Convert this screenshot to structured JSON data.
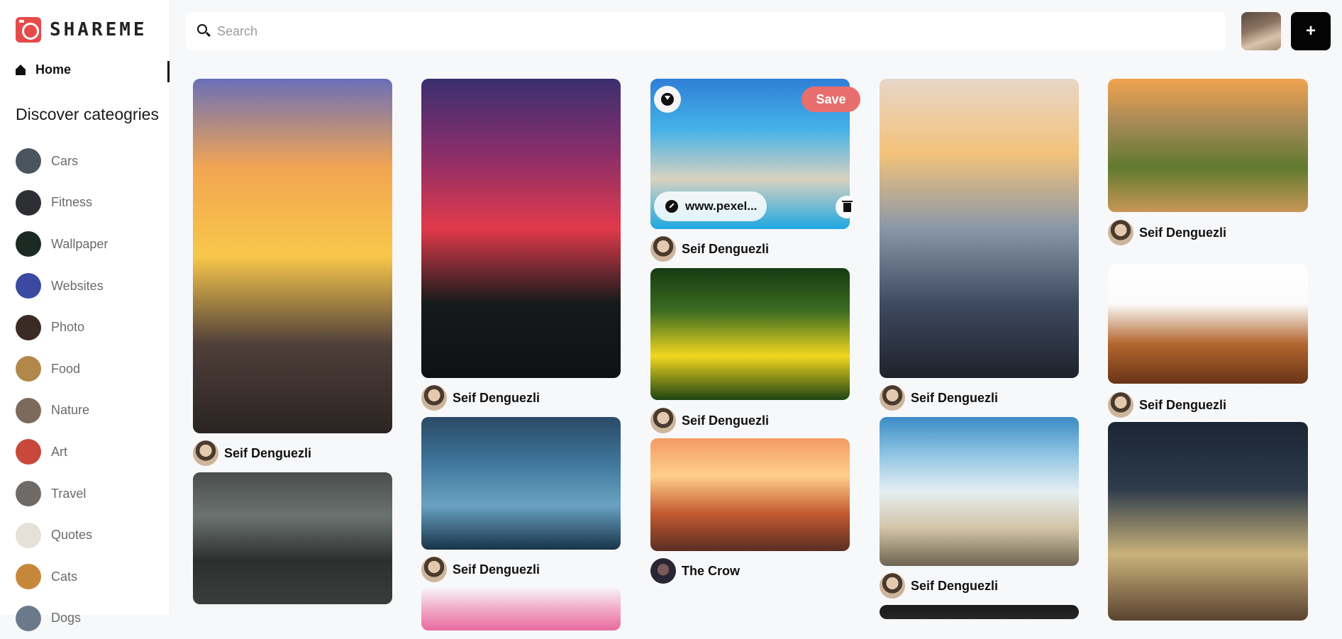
{
  "app": {
    "name": "SHAREME"
  },
  "sidebar": {
    "home_label": "Home",
    "discover_title": "Discover cateogries",
    "categories": [
      {
        "label": "Cars",
        "thumb": "#4a5560"
      },
      {
        "label": "Fitness",
        "thumb": "#2d2f33"
      },
      {
        "label": "Wallpaper",
        "thumb": "#1c2a24"
      },
      {
        "label": "Websites",
        "thumb": "#3b4aa0"
      },
      {
        "label": "Photo",
        "thumb": "#3a2c25"
      },
      {
        "label": "Food",
        "thumb": "#b2874a"
      },
      {
        "label": "Nature",
        "thumb": "#7c6a5c"
      },
      {
        "label": "Art",
        "thumb": "#c9473b"
      },
      {
        "label": "Travel",
        "thumb": "#6e6a67"
      },
      {
        "label": "Quotes",
        "thumb": "#e6e1d8"
      },
      {
        "label": "Cats",
        "thumb": "#c7873b"
      },
      {
        "label": "Dogs",
        "thumb": "#6b7a8a"
      }
    ]
  },
  "search": {
    "placeholder": "Search"
  },
  "header": {
    "add_label": "+"
  },
  "overlay": {
    "save_label": "Save",
    "link_text": "www.pexel..."
  },
  "pins": [
    {
      "author": "Seif Denguezli",
      "colors": [
        "#6a6fb8",
        "#f2a552",
        "#f8c74a",
        "#4f3f3a",
        "#2a2422"
      ]
    },
    {
      "author": "",
      "colors": [
        "#4a4f4e",
        "#6c726f",
        "#2b302f",
        "#3b3d3c"
      ]
    },
    {
      "author": "Seif Denguezli",
      "colors": [
        "#3b2f6f",
        "#8a2e6a",
        "#e23a4a",
        "#151a1b",
        "#0f1112"
      ]
    },
    {
      "author": "Seif Denguezli",
      "colors": [
        "#2a4a66",
        "#3e7599",
        "#6aa2c3",
        "#18344a"
      ]
    },
    {
      "author": "",
      "colors": [
        "#f6f3f6",
        "#f0a9c6",
        "#e96aa0"
      ]
    },
    {
      "author": "Seif Denguezli",
      "colors": [
        "#2f7fd6",
        "#43b1e8",
        "#d7d2c0",
        "#1fa7e0"
      ]
    },
    {
      "author": "Seif Denguezli",
      "colors": [
        "#153b12",
        "#3e6e22",
        "#f2d61f",
        "#1c4412"
      ]
    },
    {
      "author": "The Crow",
      "colors": [
        "#f39a62",
        "#ffcf8c",
        "#c45a30",
        "#5a2e22"
      ]
    },
    {
      "author": "Seif Denguezli",
      "colors": [
        "#e8d6c8",
        "#f3c27a",
        "#8a97a8",
        "#3f4b62",
        "#1e2129"
      ]
    },
    {
      "author": "Seif Denguezli",
      "colors": [
        "#3b8bc4",
        "#8fc4e3",
        "#e6eef2",
        "#d2c3a6",
        "#6c6351"
      ]
    },
    {
      "author": "",
      "colors": [
        "#1a1a1a",
        "#262626"
      ]
    },
    {
      "author": "Seif Denguezli",
      "colors": [
        "#f1a24f",
        "#a58a57",
        "#617a2f",
        "#c89656"
      ]
    },
    {
      "author": "Seif Denguezli",
      "colors": [
        "#ffffff",
        "#fbfbfb",
        "#b3672e",
        "#6a3418"
      ]
    },
    {
      "author": "",
      "colors": [
        "#1b2634",
        "#2d3b4b",
        "#c9b27a",
        "#5a4330"
      ]
    }
  ]
}
